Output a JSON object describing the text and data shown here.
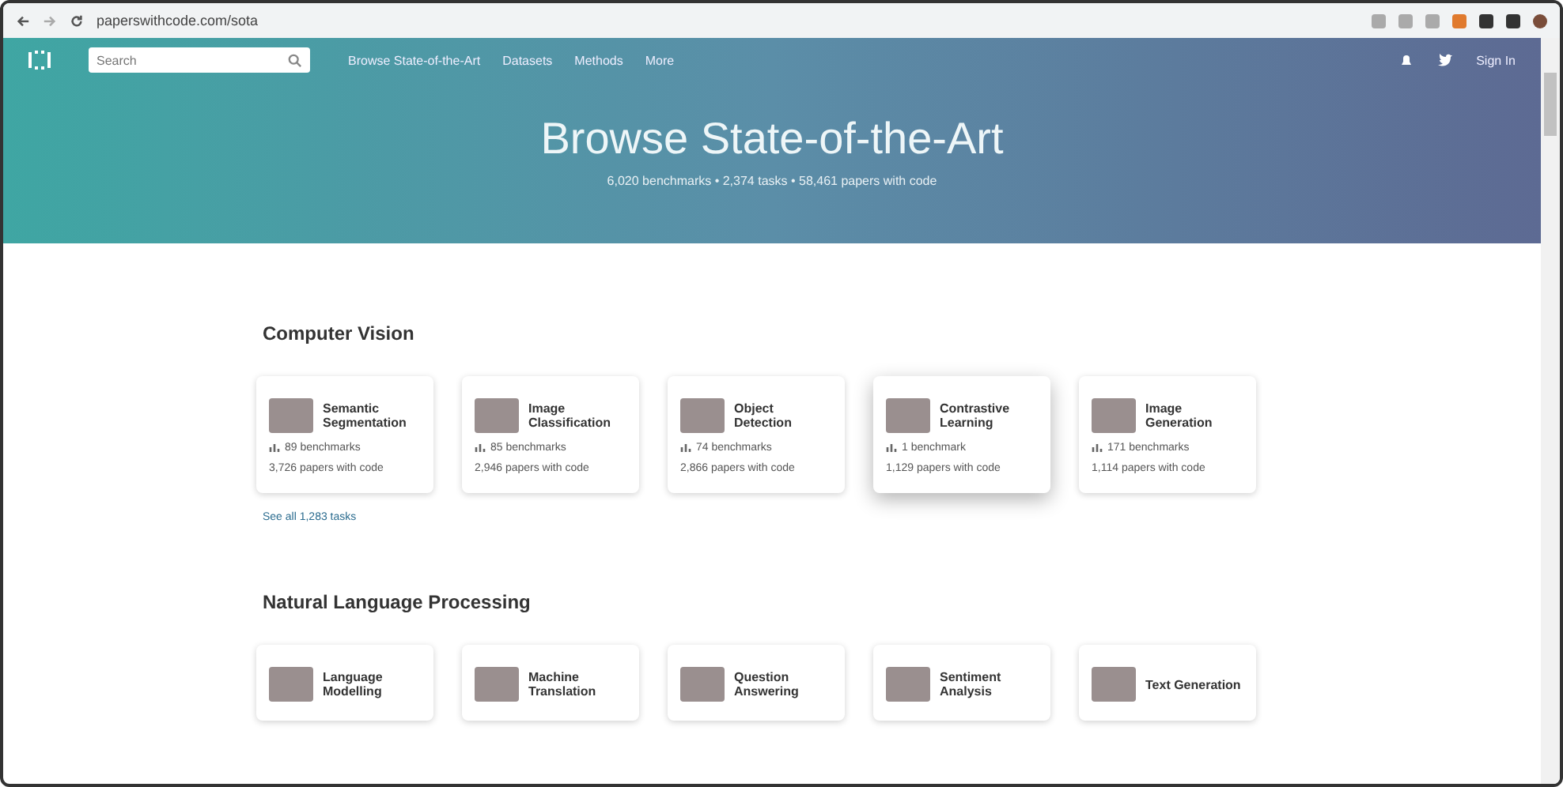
{
  "browser": {
    "url": "paperswithcode.com/sota"
  },
  "navbar": {
    "search": {
      "placeholder": "Search"
    },
    "links": [
      "Browse State-of-the-Art",
      "Datasets",
      "Methods",
      "More"
    ],
    "sign_in": "Sign In"
  },
  "hero": {
    "title": "Browse State-of-the-Art",
    "subtitle": "6,020 benchmarks • 2,374 tasks • 58,461 papers with code"
  },
  "sections": [
    {
      "title": "Computer Vision",
      "see_all": "See all 1,283 tasks",
      "tasks": [
        {
          "name": "Semantic Segmentation",
          "benchmarks": "89 benchmarks",
          "papers": "3,726 papers with code",
          "hovered": false
        },
        {
          "name": "Image Classification",
          "benchmarks": "85 benchmarks",
          "papers": "2,946 papers with code",
          "hovered": false
        },
        {
          "name": "Object Detection",
          "benchmarks": "74 benchmarks",
          "papers": "2,866 papers with code",
          "hovered": false
        },
        {
          "name": "Contrastive Learning",
          "benchmarks": "1 benchmark",
          "papers": "1,129 papers with code",
          "hovered": true
        },
        {
          "name": "Image Generation",
          "benchmarks": "171 benchmarks",
          "papers": "1,114 papers with code",
          "hovered": false
        }
      ]
    },
    {
      "title": "Natural Language Processing",
      "tasks": [
        {
          "name": "Language Modelling",
          "hovered": false
        },
        {
          "name": "Machine Translation",
          "hovered": false
        },
        {
          "name": "Question Answering",
          "hovered": false
        },
        {
          "name": "Sentiment Analysis",
          "hovered": false
        },
        {
          "name": "Text Generation",
          "hovered": false
        }
      ]
    }
  ]
}
